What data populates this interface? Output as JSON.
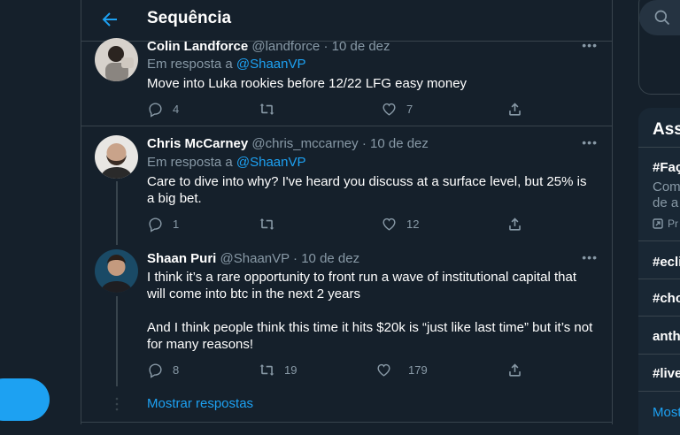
{
  "header": {
    "title": "Sequência"
  },
  "tweets": [
    {
      "name": "Colin Landforce",
      "handle": "@landforce",
      "sep": "·",
      "date": "10 de dez",
      "reply_prefix": "Em resposta a",
      "reply_to": "@ShaanVP",
      "text": "Move into Luka rookies before 12/22 LFG easy money",
      "replies": "4",
      "retweets": "",
      "likes": "7"
    },
    {
      "name": "Chris McCarney",
      "handle": "@chris_mccarney",
      "sep": "·",
      "date": "10 de dez",
      "reply_prefix": "Em resposta a",
      "reply_to": "@ShaanVP",
      "text": "Care to dive into why? I've heard you discuss at a surface level, but 25% is a big bet.",
      "replies": "1",
      "retweets": "",
      "likes": "12"
    },
    {
      "name": "Shaan Puri",
      "handle": "@ShaanVP",
      "sep": "·",
      "date": "10 de dez",
      "text": "I think it’s a rare opportunity to front run a wave of institutional capital that will come into btc in the next 2 years\n\nAnd I think people think this time it hits $20k is “just like last time” but it’s not for many reasons!",
      "replies": "8",
      "retweets": "19",
      "likes": "179"
    }
  ],
  "show_replies": "Mostrar respostas",
  "sidebar": {
    "trends_title": "Ass",
    "trend1_tag": "#Faç",
    "trend1_line2": "Com",
    "trend1_line3": "de a",
    "trend1_promo": "Pr",
    "trend2": "#ecli",
    "trend3": "#cho",
    "trend4": "anth",
    "trend5": "#live",
    "show_more": "Most"
  },
  "colors": {
    "background": "#15202b",
    "accent": "#1da1f2",
    "muted": "#8899a6",
    "border": "#38444d"
  }
}
